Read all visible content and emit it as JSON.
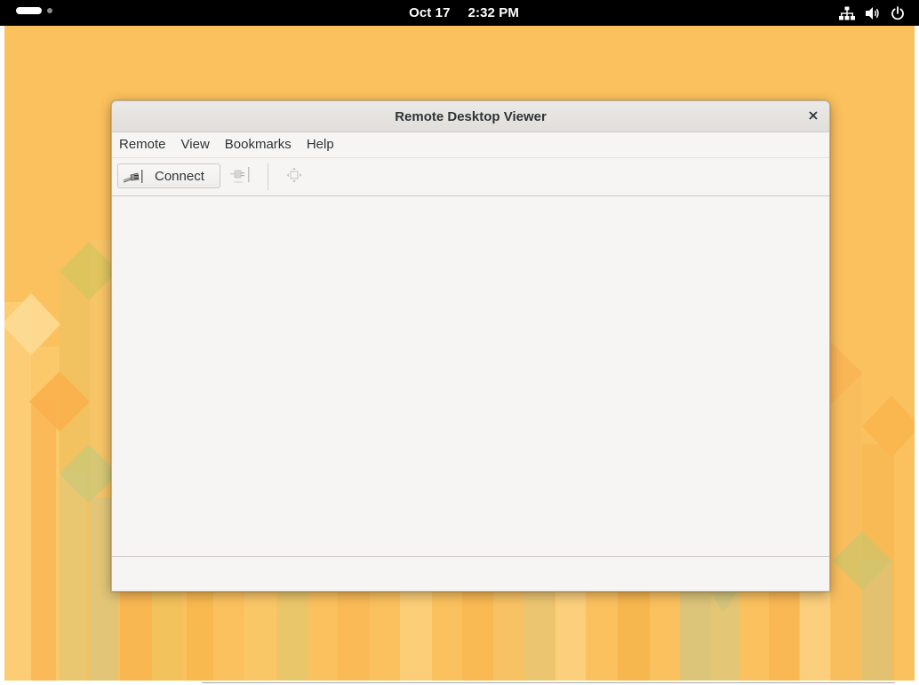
{
  "topbar": {
    "date": "Oct 17",
    "time": "2:32 PM",
    "status_icons": [
      "network-wired-icon",
      "volume-icon",
      "power-icon"
    ]
  },
  "window": {
    "title": "Remote Desktop Viewer",
    "close_icon": "close-icon",
    "menu": [
      {
        "label": "Remote"
      },
      {
        "label": "View"
      },
      {
        "label": "Bookmarks"
      },
      {
        "label": "Help"
      }
    ],
    "toolbar": {
      "connect_label": "Connect",
      "connect_icon": "connect-plug-icon",
      "disconnect_icon": "disconnect-plug-icon",
      "disconnect_enabled": false,
      "fullscreen_icon": "fullscreen-move-icon",
      "fullscreen_enabled": false
    }
  },
  "colors": {
    "desktop_background": "#fbc15e",
    "topbar": "#000000",
    "window_background": "#f6f5f4",
    "text": "#2e3436"
  }
}
